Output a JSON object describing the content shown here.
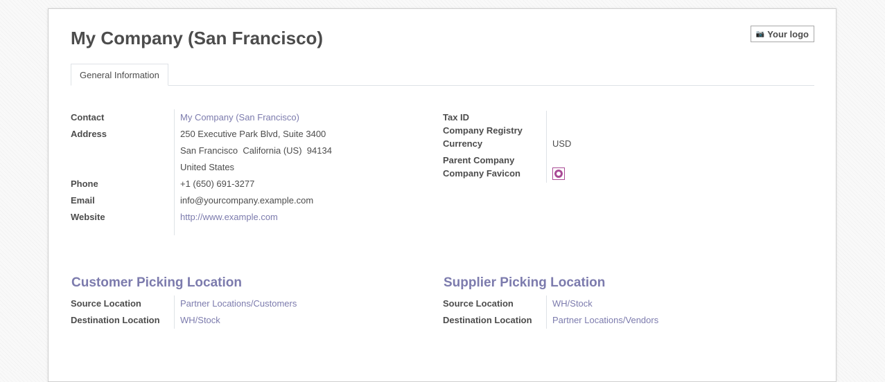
{
  "company": {
    "title": "My Company (San Francisco)"
  },
  "logo_button": {
    "label": "Your logo",
    "icon": "camera-icon"
  },
  "tabs": [
    {
      "label": "General Information"
    }
  ],
  "left_fields": {
    "contact": {
      "label": "Contact",
      "value": "My Company (San Francisco)"
    },
    "address": {
      "label": "Address",
      "line1": "250 Executive Park Blvd, Suite 3400",
      "line2": "San Francisco  California (US)  94134",
      "line3": "United States"
    },
    "phone": {
      "label": "Phone",
      "value": "+1 (650) 691-3277"
    },
    "email": {
      "label": "Email",
      "value": "info@yourcompany.example.com"
    },
    "website": {
      "label": "Website",
      "value": "http://www.example.com"
    }
  },
  "right_fields": {
    "tax_id": {
      "label": "Tax ID",
      "value": ""
    },
    "company_registry": {
      "label": "Company Registry",
      "value": ""
    },
    "currency": {
      "label": "Currency",
      "value": "USD"
    },
    "parent_company": {
      "label": "Parent Company",
      "value": ""
    },
    "company_favicon": {
      "label": "Company Favicon",
      "icon": "favicon-circle-icon"
    }
  },
  "customer_picking": {
    "title": "Customer Picking Location",
    "source": {
      "label": "Source Location",
      "value": "Partner Locations/Customers"
    },
    "destination": {
      "label": "Destination Location",
      "value": "WH/Stock"
    }
  },
  "supplier_picking": {
    "title": "Supplier Picking Location",
    "source": {
      "label": "Source Location",
      "value": "WH/Stock"
    },
    "destination": {
      "label": "Destination Location",
      "value": "Partner Locations/Vendors"
    }
  },
  "colors": {
    "link": "#7c7bad",
    "text": "#4c4c4c",
    "favicon": "#a94a95"
  }
}
